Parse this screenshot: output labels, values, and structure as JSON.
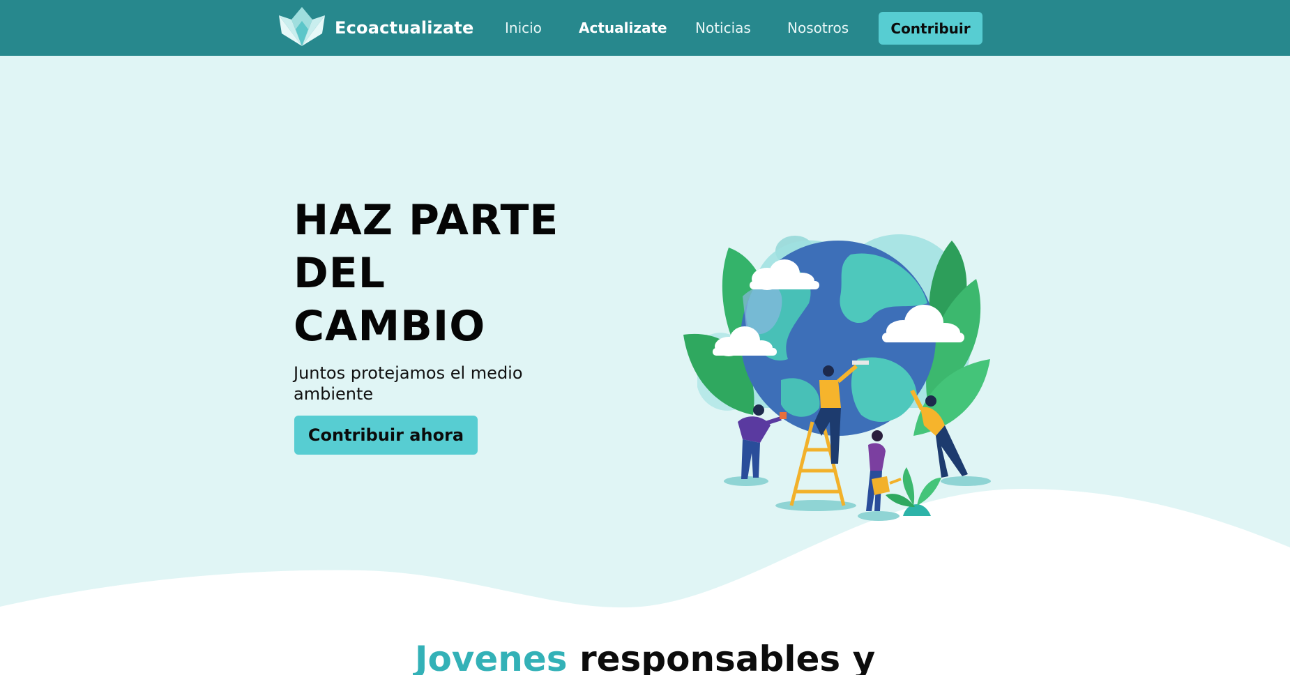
{
  "navbar": {
    "brand_name": "Ecoactualizate",
    "links": [
      {
        "label": "Inicio"
      },
      {
        "label": "Actualizate"
      },
      {
        "label": "Noticias"
      },
      {
        "label": "Nosotros"
      }
    ],
    "cta_label": "Contribuir"
  },
  "hero": {
    "title_lines": [
      "HAZ PARTE",
      "DEL",
      "CAMBIO"
    ],
    "subtitle": "Juntos protejamos el medio ambiente",
    "cta_label": "Contribuir ahora"
  },
  "section": {
    "heading_accent": "Jovenes",
    "heading_rest": " responsables y"
  },
  "colors": {
    "navbar": "#27888d",
    "accent_button": "#57cdd2",
    "hero_background": "#e0f5f5",
    "heading_accent": "#33b1b7"
  }
}
